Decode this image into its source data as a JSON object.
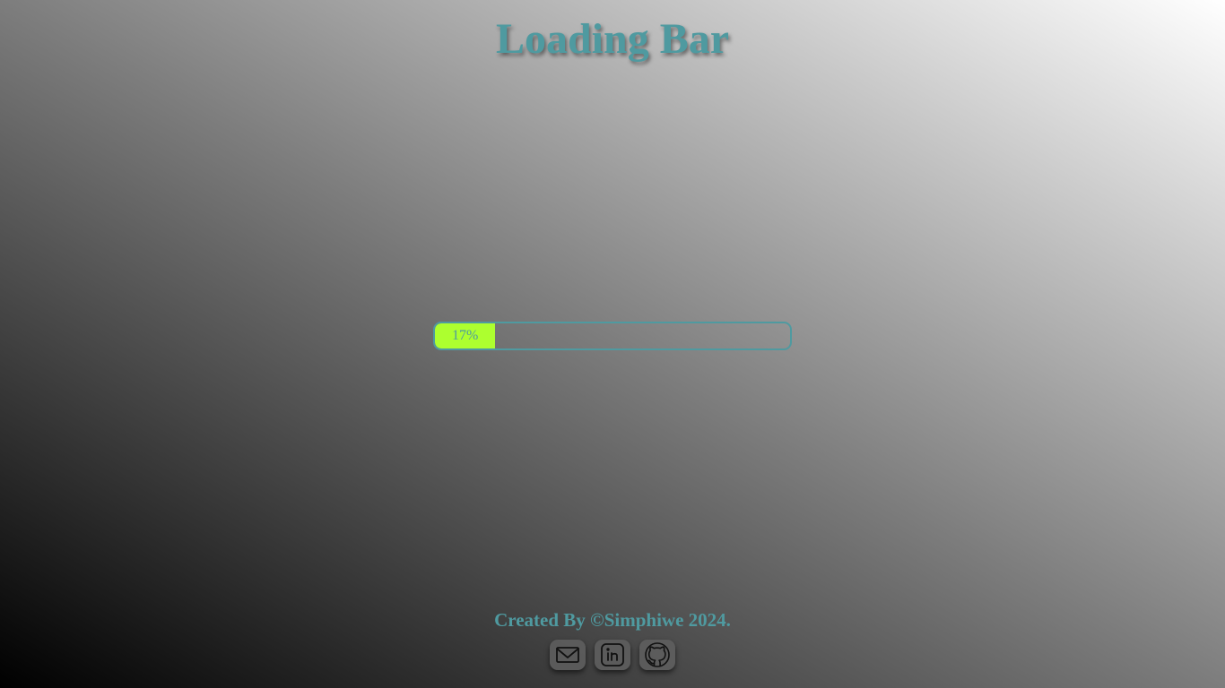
{
  "header": {
    "title": "Loading Bar"
  },
  "progress": {
    "percent": 17,
    "label": "17%",
    "fill_color": "#adff2f",
    "accent_color": "#4f9aa0"
  },
  "footer": {
    "credit": "Created By ©Simphiwe 2024.",
    "links": [
      {
        "icon": "mail-icon"
      },
      {
        "icon": "linkedin-icon"
      },
      {
        "icon": "github-icon"
      }
    ]
  }
}
